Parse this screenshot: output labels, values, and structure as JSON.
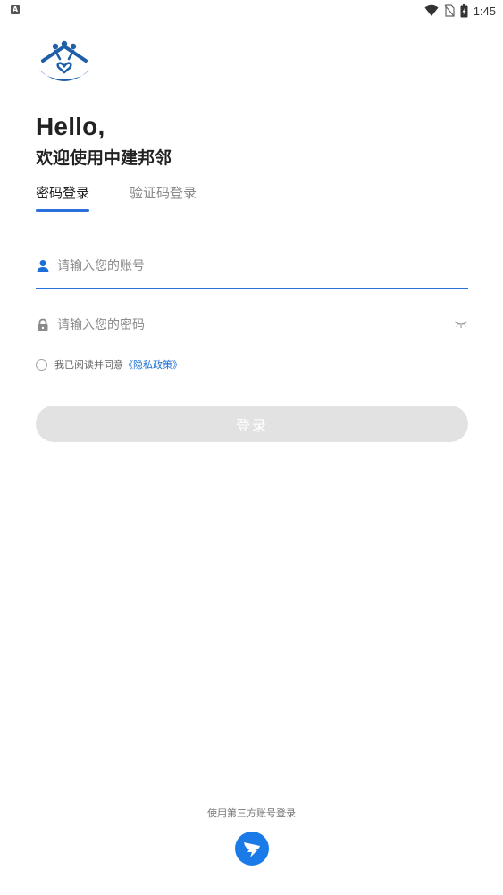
{
  "status_bar": {
    "time": "1:45",
    "left_icon": "A"
  },
  "header": {
    "greeting": "Hello,",
    "welcome": "欢迎使用中建邦邻"
  },
  "tabs": [
    {
      "label": "密码登录",
      "active": true
    },
    {
      "label": "验证码登录",
      "active": false
    }
  ],
  "form": {
    "account_placeholder": "请输入您的账号",
    "password_placeholder": "请输入您的密码",
    "agree_text": "我已阅读并同意",
    "policy_link": "《隐私政策》",
    "login_label": "登录"
  },
  "third_party": {
    "label": "使用第三方账号登录"
  },
  "colors": {
    "accent": "#2a6fdb",
    "link": "#1a6fd8",
    "button_disabled": "#e2e2e2",
    "third_party_icon": "#1a7ae8"
  }
}
